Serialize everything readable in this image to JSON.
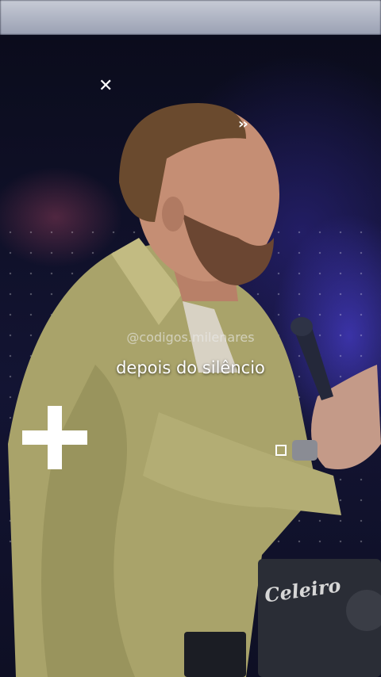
{
  "video": {
    "watermark": "@codigos.milenares",
    "caption": "depois do silêncio",
    "laptop_sticker": "Celeiro"
  },
  "overlay_icons": [
    "close-icon",
    "chevron-right-icon",
    "plus-icon",
    "square-icon"
  ],
  "colors": {
    "background": "#0b0d1e",
    "stage_light": "#4a3cc8",
    "jacket": "#a9a36a",
    "caption_text": "#ffffff"
  }
}
